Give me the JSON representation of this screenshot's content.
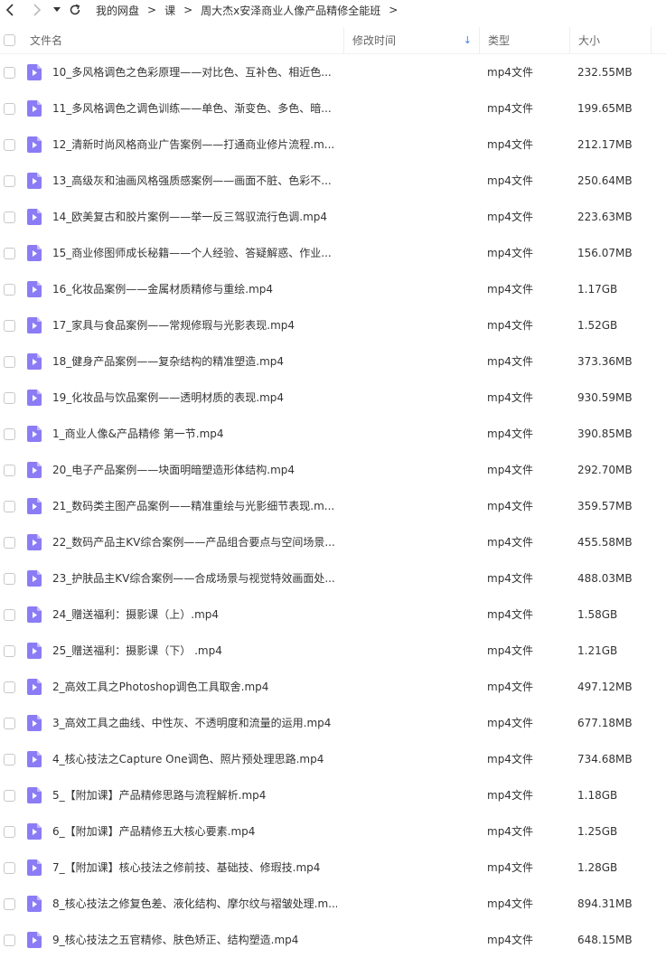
{
  "toolbar": {
    "back_icon": "chevron-left-icon",
    "forward_icon": "chevron-right-icon",
    "history_icon": "dropdown-triangle-icon",
    "refresh_icon": "refresh-icon"
  },
  "breadcrumb": {
    "items": [
      "我的网盘",
      "课",
      "周大杰x安泽商业人像产品精修全能班"
    ],
    "separator": ">"
  },
  "header": {
    "name": "文件名",
    "mtime": "修改时间",
    "type": "类型",
    "size": "大小",
    "sort_indicator": "↓"
  },
  "colors": {
    "icon_purple": "#8b7cf6",
    "sort_blue": "#3b82f6"
  },
  "files": [
    {
      "name": "10_多风格调色之色彩原理——对比色、互补色、相近色...",
      "type": "mp4文件",
      "size": "232.55MB"
    },
    {
      "name": "11_多风格调色之调色训练——单色、渐变色、多色、暗...",
      "type": "mp4文件",
      "size": "199.65MB"
    },
    {
      "name": "12_清新时尚风格商业广告案例——打通商业修片流程.m...",
      "type": "mp4文件",
      "size": "212.17MB"
    },
    {
      "name": "13_高级灰和油画风格强质感案例——画面不脏、色彩不...",
      "type": "mp4文件",
      "size": "250.64MB"
    },
    {
      "name": "14_欧美复古和胶片案例——举一反三驾驭流行色调.mp4",
      "type": "mp4文件",
      "size": "223.63MB"
    },
    {
      "name": "15_商业修图师成长秘籍——个人经验、答疑解惑、作业...",
      "type": "mp4文件",
      "size": "156.07MB"
    },
    {
      "name": "16_化妆品案例——金属材质精修与重绘.mp4",
      "type": "mp4文件",
      "size": "1.17GB"
    },
    {
      "name": "17_家具与食品案例——常规修瑕与光影表现.mp4",
      "type": "mp4文件",
      "size": "1.52GB"
    },
    {
      "name": "18_健身产品案例——复杂结构的精准塑造.mp4",
      "type": "mp4文件",
      "size": "373.36MB"
    },
    {
      "name": "19_化妆品与饮品案例——透明材质的表现.mp4",
      "type": "mp4文件",
      "size": "930.59MB"
    },
    {
      "name": "1_商业人像&产品精修 第一节.mp4",
      "type": "mp4文件",
      "size": "390.85MB"
    },
    {
      "name": "20_电子产品案例——块面明暗塑造形体结构.mp4",
      "type": "mp4文件",
      "size": "292.70MB"
    },
    {
      "name": "21_数码类主图产品案例——精准重绘与光影细节表现.m...",
      "type": "mp4文件",
      "size": "359.57MB"
    },
    {
      "name": "22_数码产品主KV综合案例——产品组合要点与空间场景...",
      "type": "mp4文件",
      "size": "455.58MB"
    },
    {
      "name": "23_护肤品主KV综合案例——合成场景与视觉特效画面处...",
      "type": "mp4文件",
      "size": "488.03MB"
    },
    {
      "name": "24_赠送福利：摄影课（上）.mp4",
      "type": "mp4文件",
      "size": "1.58GB"
    },
    {
      "name": "25_赠送福利：摄影课（下） .mp4",
      "type": "mp4文件",
      "size": "1.21GB"
    },
    {
      "name": "2_高效工具之Photoshop调色工具取舍.mp4",
      "type": "mp4文件",
      "size": "497.12MB"
    },
    {
      "name": "3_高效工具之曲线、中性灰、不透明度和流量的运用.mp4",
      "type": "mp4文件",
      "size": "677.18MB"
    },
    {
      "name": "4_核心技法之Capture One调色、照片预处理思路.mp4",
      "type": "mp4文件",
      "size": "734.68MB"
    },
    {
      "name": "5_【附加课】产品精修思路与流程解析.mp4",
      "type": "mp4文件",
      "size": "1.18GB"
    },
    {
      "name": "6_【附加课】产品精修五大核心要素.mp4",
      "type": "mp4文件",
      "size": "1.25GB"
    },
    {
      "name": "7_【附加课】核心技法之修前技、基础技、修瑕技.mp4",
      "type": "mp4文件",
      "size": "1.28GB"
    },
    {
      "name": "8_核心技法之修复色差、液化结构、摩尔纹与褶皱处理.m...",
      "type": "mp4文件",
      "size": "894.31MB"
    },
    {
      "name": "9_核心技法之五官精修、肤色矫正、结构塑造.mp4",
      "type": "mp4文件",
      "size": "648.15MB"
    }
  ]
}
